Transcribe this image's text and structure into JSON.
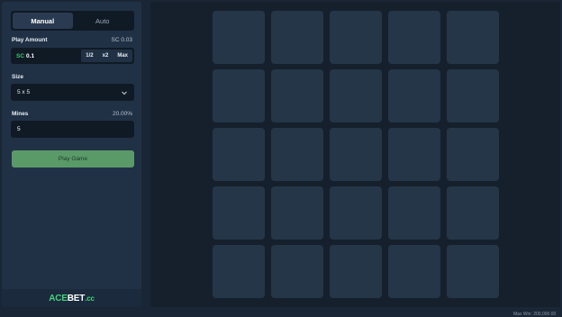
{
  "mode_tabs": [
    "Manual",
    "Auto"
  ],
  "play_amount": {
    "label": "Play Amount",
    "balance": "SC 0.03",
    "currency": "SC",
    "value": "0.1",
    "actions": [
      "1/2",
      "x2",
      "Max"
    ]
  },
  "size": {
    "label": "Size",
    "value": "5 x 5"
  },
  "mines": {
    "label": "Mines",
    "percent": "20.00%",
    "value": "5"
  },
  "play_button": "Play Game",
  "logo": {
    "part1": "ACE",
    "part2": "BET",
    "part3": ".cc"
  },
  "board": {
    "rows": 5,
    "cols": 5
  },
  "max_win": "Max Win: 200,000.00"
}
